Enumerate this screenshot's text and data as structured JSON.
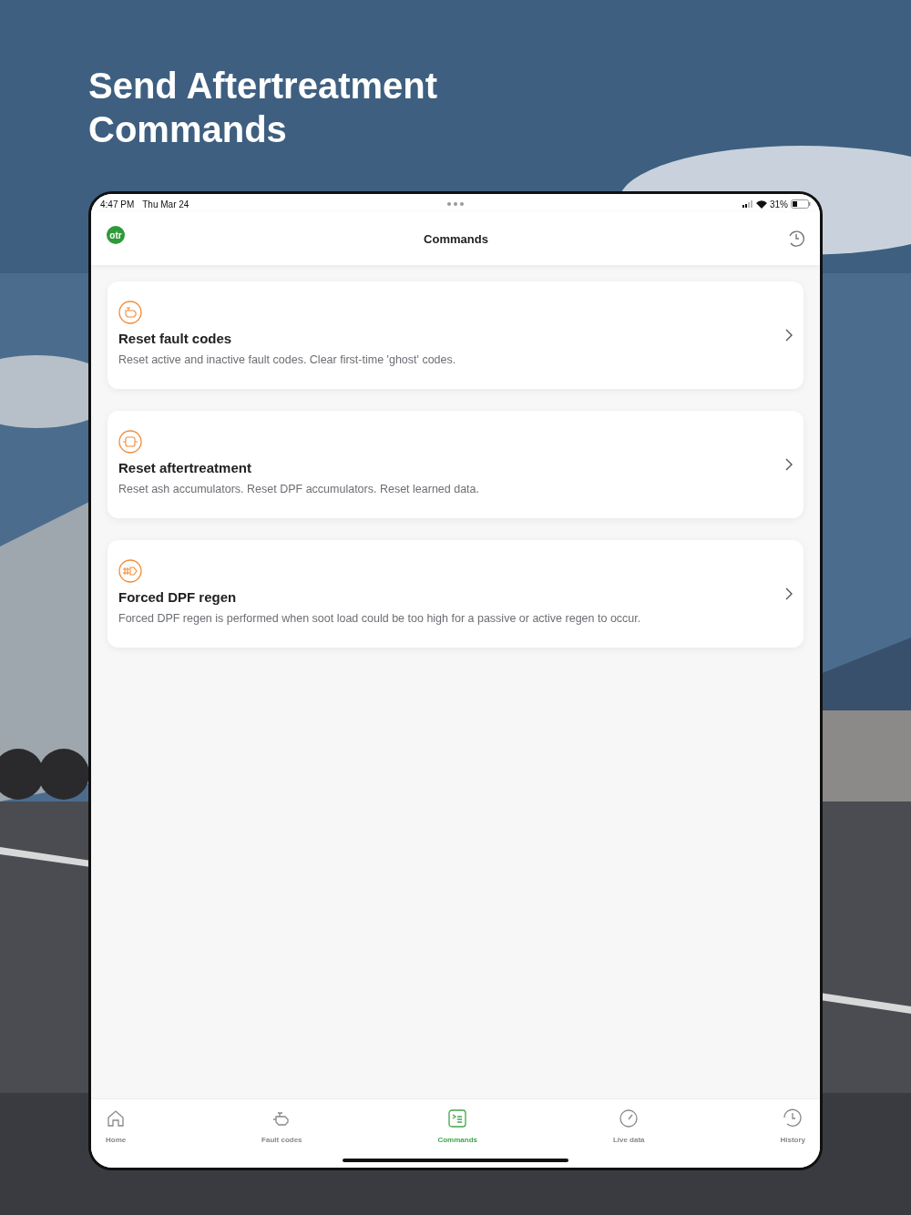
{
  "headline": "Send Aftertreatment Commands",
  "status_bar": {
    "time": "4:47 PM",
    "date": "Thu Mar 24",
    "battery": "31%"
  },
  "header": {
    "logo": "otr",
    "title": "Commands"
  },
  "commands": [
    {
      "kind": "engine",
      "title": "Reset fault codes",
      "description": "Reset active and inactive fault codes. Clear first-time 'ghost' codes."
    },
    {
      "kind": "filter",
      "title": "Reset aftertreatment",
      "description": "Reset ash accumulators. Reset DPF accumulators. Reset learned data."
    },
    {
      "kind": "regen",
      "title": "Forced DPF regen",
      "description": "Forced DPF regen is performed when soot load could be too high for a passive or active regen to occur."
    }
  ],
  "tabs": [
    {
      "kind": "home",
      "label": "Home",
      "selected": false
    },
    {
      "kind": "engine",
      "label": "Fault codes",
      "selected": false
    },
    {
      "kind": "commands",
      "label": "Commands",
      "selected": true
    },
    {
      "kind": "gauge",
      "label": "Live data",
      "selected": false
    },
    {
      "kind": "history",
      "label": "History",
      "selected": false
    }
  ]
}
